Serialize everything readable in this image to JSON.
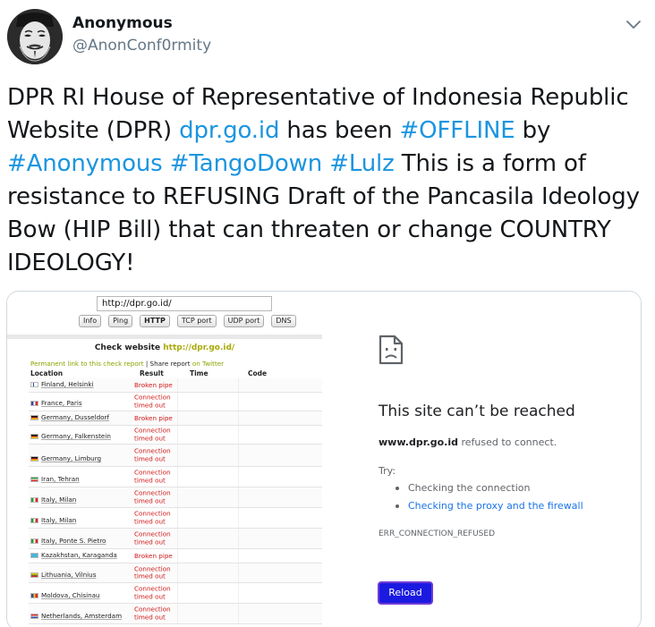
{
  "tweet": {
    "display_name": "Anonymous",
    "handle": "@AnonConf0rmity",
    "text": {
      "p1": "DPR RI House of Representative of Indonesia Republic Website (DPR) ",
      "link": "dpr.go.id",
      "p2": " has been ",
      "tag1": "#OFFLINE",
      "p3": " by ",
      "tag2": "#Anonymous",
      "sp1": " ",
      "tag3": "#TangoDown",
      "sp2": " ",
      "tag4": "#Lulz",
      "p4": " This is a form of resistance to REFUSING Draft of the Pancasila Ideology Bow (HIP Bill) that can threaten or change COUNTRY IDEOLOGY!"
    },
    "link_color": "#1b95e0"
  },
  "checkhost": {
    "url_value": "http://dpr.go.id/",
    "buttons": [
      "Info",
      "Ping",
      "HTTP",
      "TCP port",
      "UDP port",
      "DNS"
    ],
    "active_button": "HTTP",
    "title_prefix": "Check website ",
    "title_url": "http://dpr.go.id/",
    "permalink": "Permanent link to this check report",
    "share_sep": " | Share report ",
    "share_target": "on Twitter",
    "columns": [
      "Location",
      "Result",
      "Time",
      "Code"
    ],
    "rows": [
      {
        "location": "Finland, Helsinki",
        "result": "Broken pipe",
        "flag": "fi",
        "h": 16
      },
      {
        "location": "France, Paris",
        "result": "Connection timed out",
        "flag": "fr",
        "h": 21
      },
      {
        "location": "Germany, Dusseldorf",
        "result": "Broken pipe",
        "flag": "de",
        "h": 16
      },
      {
        "location": "Germany, Falkenstein",
        "result": "Connection timed out",
        "flag": "de",
        "h": 21
      },
      {
        "location": "Germany, Limburg",
        "result": "Connection timed out",
        "flag": "de",
        "h": 25
      },
      {
        "location": "Iran, Tehran",
        "result": "Connection timed out",
        "flag": "ir",
        "h": 23
      },
      {
        "location": "Italy, Milan",
        "result": "Connection timed out",
        "flag": "it",
        "h": 23
      },
      {
        "location": "Italy, Milan",
        "result": "Connection timed out",
        "flag": "it",
        "h": 23
      },
      {
        "location": "Italy, Ponte S. Pietro",
        "result": "Connection timed out",
        "flag": "it",
        "h": 23
      },
      {
        "location": "Kazakhstan, Karaganda",
        "result": "Broken pipe",
        "flag": "kz",
        "h": 16
      },
      {
        "location": "Lithuania, Vilnius",
        "result": "Connection timed out",
        "flag": "lt",
        "h": 22
      },
      {
        "location": "Moldova, Chisinau",
        "result": "Connection timed out",
        "flag": "md",
        "h": 23
      },
      {
        "location": "Netherlands, Amsterdam",
        "result": "Connection timed out",
        "flag": "nl",
        "h": 23
      }
    ]
  },
  "chrome_error": {
    "icon": "sad-document-icon",
    "title": "This site can’t be reached",
    "host": "www.dpr.go.id",
    "refused": " refused to connect.",
    "try_label": "Try:",
    "suggestions": [
      "Checking the connection",
      "Checking the proxy and the firewall"
    ],
    "error_code": "ERR_CONNECTION_REFUSED",
    "reload_label": "Reload",
    "reload_color": "#1a1ae0"
  }
}
